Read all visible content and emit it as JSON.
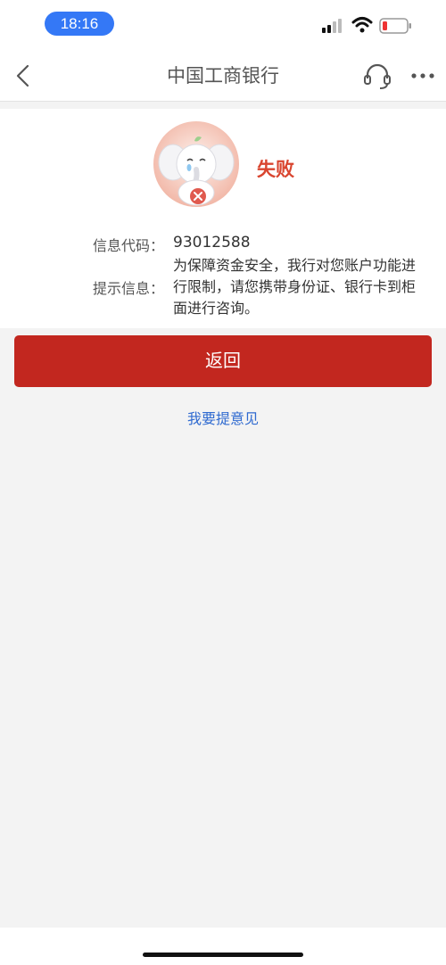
{
  "status_bar": {
    "time": "18:16",
    "icons": [
      "signal-icon",
      "wifi-icon",
      "battery-low-icon"
    ]
  },
  "nav": {
    "title": "中国工商银行",
    "icons": [
      "back-chevron-icon",
      "headset-icon",
      "more-dots-icon"
    ]
  },
  "result": {
    "status": "失败",
    "mascot": "crying-elephant-icon",
    "code_label": "信息代码：",
    "code_value": "93012588",
    "message_label": "提示信息：",
    "message_value": "为保障资金安全，我行对您账户功能进行限制，请您携带身份证、银行卡到柜面进行咨询。"
  },
  "actions": {
    "return_label": "返回",
    "feedback_label": "我要提意见"
  },
  "colors": {
    "accent_red": "#c2271f",
    "status_red": "#d9452f",
    "link_blue": "#2f6ad0",
    "time_pill_blue": "#3478f6"
  }
}
